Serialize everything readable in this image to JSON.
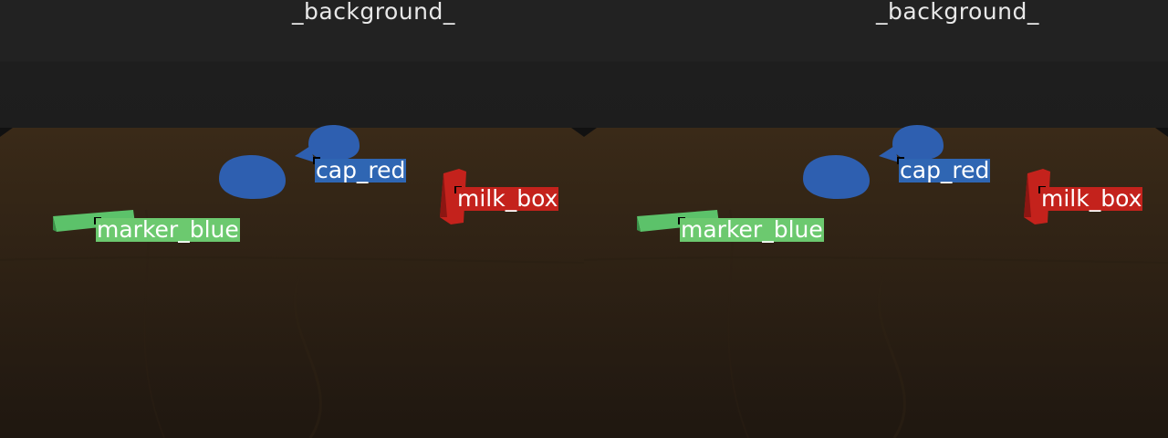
{
  "views": [
    {
      "id": "left",
      "background_label": "_background_",
      "objects": [
        {
          "label": "cap_red",
          "color": "#2f66b3"
        },
        {
          "label": "milk_box",
          "color": "#c4221c"
        },
        {
          "label": "marker_blue",
          "color": "#6cc96f"
        }
      ]
    },
    {
      "id": "right",
      "background_label": "_background_",
      "objects": [
        {
          "label": "cap_red",
          "color": "#2f66b3"
        },
        {
          "label": "milk_box",
          "color": "#c4221c"
        },
        {
          "label": "marker_blue",
          "color": "#6cc96f"
        }
      ]
    }
  ]
}
